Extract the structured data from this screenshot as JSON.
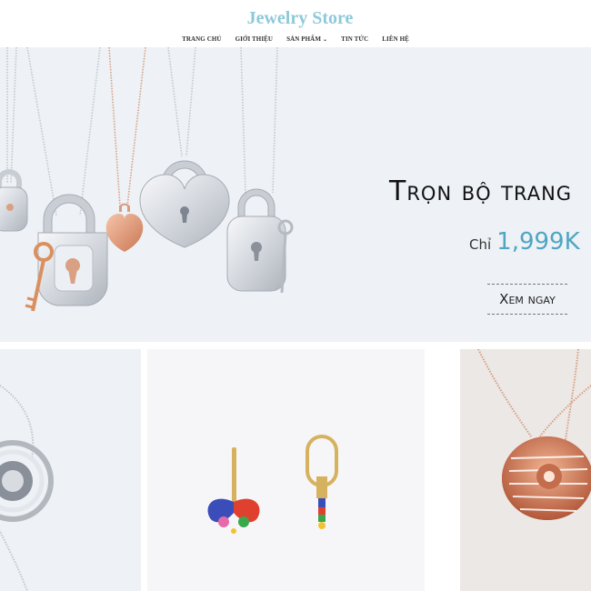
{
  "header": {
    "brand": "Jewelry Store",
    "nav": [
      {
        "label": "TRANG CHỦ"
      },
      {
        "label": "GIỚI THIỆU"
      },
      {
        "label": "SẢN PHẨM",
        "has_dropdown": true
      },
      {
        "label": "TIN TỨC"
      },
      {
        "label": "LIÊN HỆ"
      }
    ]
  },
  "hero": {
    "title": "Trọn bộ trang",
    "price_prefix": "Chỉ",
    "price_value": "1,999K",
    "cta_label": "Xem ngay"
  },
  "colors": {
    "brand": "#8ec9da",
    "price": "#4ea6c3",
    "hero_bg": "#eef1f6",
    "rose_gold": "#e49a78",
    "silver": "#d8dce1"
  },
  "cards": [
    {
      "icon": "silver-pendant-icon"
    },
    {
      "icon": "butterfly-earrings-icon"
    },
    {
      "icon": "rose-gold-pendant-icon"
    }
  ]
}
